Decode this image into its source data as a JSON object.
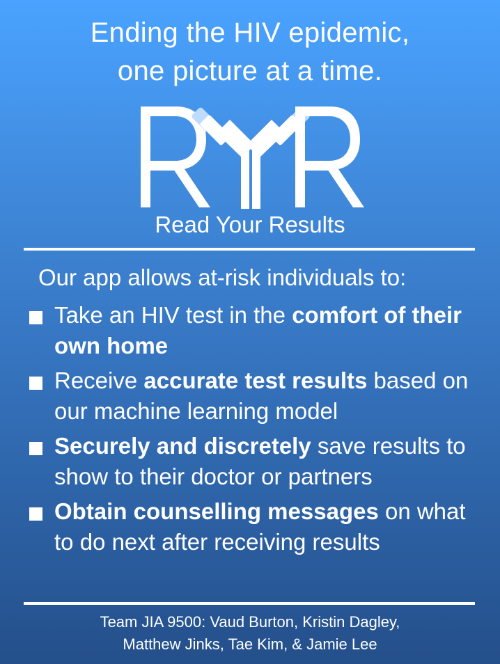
{
  "headline": {
    "line1": "Ending the HIV epidemic,",
    "line2": "one picture at a time."
  },
  "logo": {
    "text": "RYR",
    "icon": "antibody-y-icon",
    "colors": {
      "primary": "#ffffff",
      "accent": "#bddcff"
    }
  },
  "app_name": "Read Your Results",
  "intro": "Our app allows at-risk individuals to:",
  "features": [
    {
      "parts": [
        {
          "text": "Take an HIV test in the ",
          "bold": false
        },
        {
          "text": "comfort of their own home",
          "bold": true
        }
      ]
    },
    {
      "parts": [
        {
          "text": "Receive ",
          "bold": false
        },
        {
          "text": "accurate test results",
          "bold": true
        },
        {
          "text": " based on our machine learning model",
          "bold": false
        }
      ]
    },
    {
      "parts": [
        {
          "text": "Securely and discretely",
          "bold": true
        },
        {
          "text": " save results to show to their doctor or partners",
          "bold": false
        }
      ]
    },
    {
      "parts": [
        {
          "text": "Obtain counselling messages",
          "bold": true
        },
        {
          "text": " on what to do next after receiving results",
          "bold": false
        }
      ]
    }
  ],
  "credits": {
    "line1": "Team JIA 9500: Vaud Burton, Kristin Dagley,",
    "line2": "Matthew Jinks, Tae Kim, & Jamie Lee"
  },
  "colors": {
    "background_top": "#4aa3ff",
    "background_bottom": "#244f8a",
    "text": "#ffffff"
  }
}
